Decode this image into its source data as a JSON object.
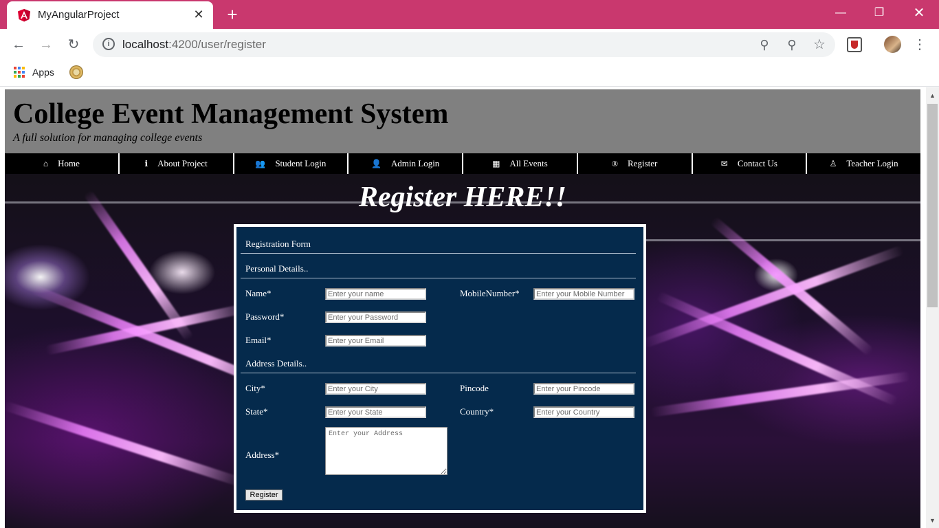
{
  "browser": {
    "tab_title": "MyAngularProject",
    "tab_close_glyph": "✕",
    "new_tab_glyph": "+",
    "url_host": "localhost",
    "url_path": ":4200/user/register",
    "bookmarks": {
      "apps_label": "Apps"
    },
    "icons": [
      "angular-favicon",
      "back-arrow-icon",
      "forward-arrow-icon",
      "reload-icon",
      "info-icon",
      "key-icon",
      "zoom-out-icon",
      "star-icon",
      "extension-icon",
      "profile-avatar",
      "menu-kebab-icon",
      "apps-grid-icon",
      "bookmark-favicon"
    ]
  },
  "site": {
    "title": "College Event Management System",
    "tagline": "A full solution for managing college events"
  },
  "nav": {
    "items": [
      {
        "label": "Home",
        "icon": "home-icon",
        "glyph": "⌂"
      },
      {
        "label": "About Project",
        "icon": "info-icon",
        "glyph": "ℹ"
      },
      {
        "label": "Student Login",
        "icon": "users-icon",
        "glyph": "👥"
      },
      {
        "label": "Admin Login",
        "icon": "user-icon",
        "glyph": "👤"
      },
      {
        "label": "All Events",
        "icon": "calendar-icon",
        "glyph": "▦"
      },
      {
        "label": "Register",
        "icon": "registered-icon",
        "glyph": "®"
      },
      {
        "label": "Contact Us",
        "icon": "envelope-icon",
        "glyph": "✉"
      },
      {
        "label": "Teacher Login",
        "icon": "user-outline-icon",
        "glyph": "♙"
      }
    ]
  },
  "page": {
    "heading": "Register HERE!!"
  },
  "form": {
    "title": "Registration Form",
    "personal_section": "Personal Details..",
    "address_section": "Address Details..",
    "fields": {
      "name": {
        "label": "Name*",
        "placeholder": "Enter your name",
        "value": ""
      },
      "mobile": {
        "label": "MobileNumber*",
        "placeholder": "Enter your Mobile Number",
        "value": ""
      },
      "password": {
        "label": "Password*",
        "placeholder": "Enter your Password",
        "value": ""
      },
      "email": {
        "label": "Email*",
        "placeholder": "Enter your Email",
        "value": ""
      },
      "city": {
        "label": "City*",
        "placeholder": "Enter your City",
        "value": ""
      },
      "pincode": {
        "label": "Pincode",
        "placeholder": "Enter your Pincode",
        "value": ""
      },
      "state": {
        "label": "State*",
        "placeholder": "Enter your State",
        "value": ""
      },
      "country": {
        "label": "Country*",
        "placeholder": "Enter your Country",
        "value": ""
      },
      "address": {
        "label": "Address*",
        "placeholder": "Enter your Address",
        "value": ""
      }
    },
    "submit_label": "Register"
  },
  "colors": {
    "tab_strip": "#c9386e",
    "header_bg": "#808080",
    "nav_bg": "#000000",
    "form_bg": "#052a4c"
  }
}
